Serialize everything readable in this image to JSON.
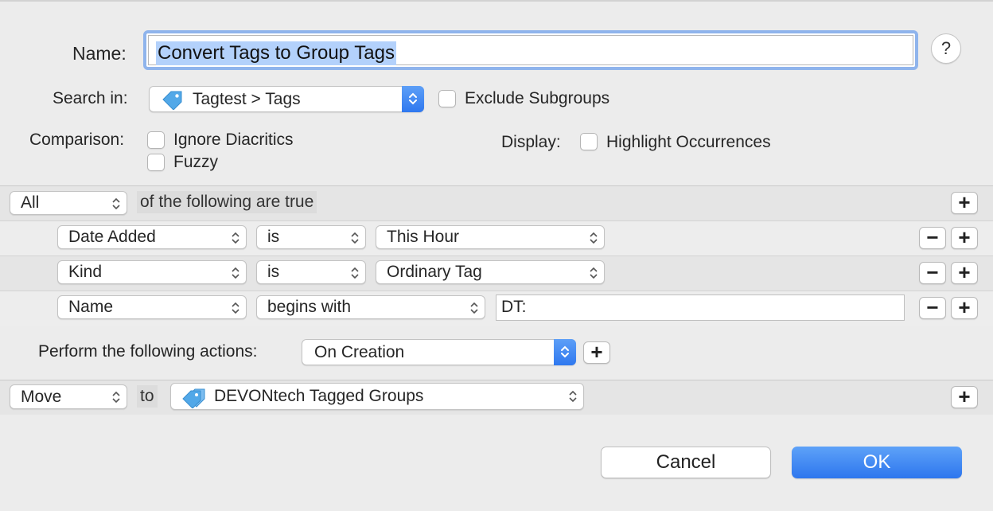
{
  "form": {
    "name_label": "Name:",
    "name_value": "Convert Tags to Group Tags",
    "help_glyph": "?",
    "search_in_label": "Search in:",
    "search_in_value": "Tagtest > Tags",
    "exclude_subgroups_label": "Exclude Subgroups",
    "comparison_label": "Comparison:",
    "ignore_diacritics_label": "Ignore Diacritics",
    "fuzzy_label": "Fuzzy",
    "display_label": "Display:",
    "highlight_label": "Highlight Occurrences"
  },
  "conditions": {
    "match_value": "All",
    "match_suffix": "of the following are true",
    "rows": [
      {
        "field": "Date Added",
        "operator": "is",
        "value": "This Hour"
      },
      {
        "field": "Kind",
        "operator": "is",
        "value": "Ordinary Tag"
      },
      {
        "field": "Name",
        "operator": "begins with",
        "value": "DT:"
      }
    ]
  },
  "actions": {
    "label": "Perform the following actions:",
    "trigger": "On Creation",
    "action": "Move",
    "to_label": "to",
    "destination": "DEVONtech Tagged Groups"
  },
  "buttons": {
    "cancel": "Cancel",
    "ok": "OK",
    "plus": "+",
    "minus": "−"
  },
  "icons": {
    "tag": "tag-icon",
    "tags": "tags-icon",
    "chevron": "updown-chevron-icon"
  },
  "colors": {
    "accent": "#2f78ef",
    "selection": "#b3d1fb",
    "focus_ring": "#8fb4ec",
    "tag_icon": "#52a8e8"
  }
}
